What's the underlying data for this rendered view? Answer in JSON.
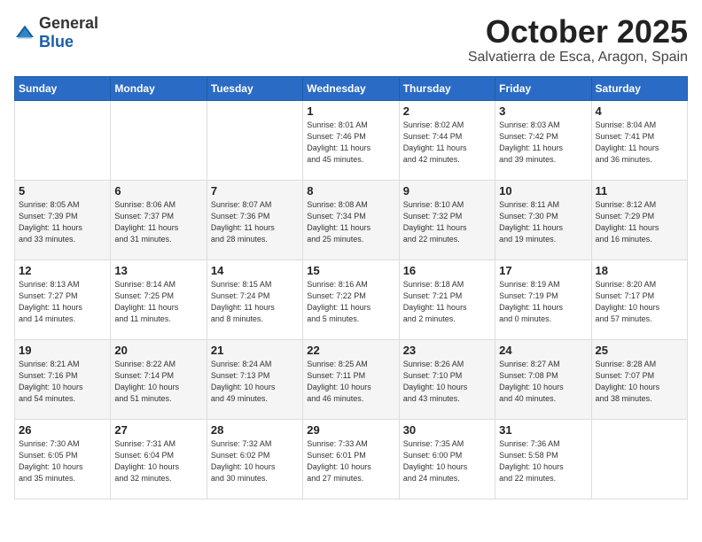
{
  "header": {
    "logo_general": "General",
    "logo_blue": "Blue",
    "month": "October 2025",
    "location": "Salvatierra de Esca, Aragon, Spain"
  },
  "weekdays": [
    "Sunday",
    "Monday",
    "Tuesday",
    "Wednesday",
    "Thursday",
    "Friday",
    "Saturday"
  ],
  "weeks": [
    [
      {
        "day": "",
        "info": ""
      },
      {
        "day": "",
        "info": ""
      },
      {
        "day": "",
        "info": ""
      },
      {
        "day": "1",
        "info": "Sunrise: 8:01 AM\nSunset: 7:46 PM\nDaylight: 11 hours\nand 45 minutes."
      },
      {
        "day": "2",
        "info": "Sunrise: 8:02 AM\nSunset: 7:44 PM\nDaylight: 11 hours\nand 42 minutes."
      },
      {
        "day": "3",
        "info": "Sunrise: 8:03 AM\nSunset: 7:42 PM\nDaylight: 11 hours\nand 39 minutes."
      },
      {
        "day": "4",
        "info": "Sunrise: 8:04 AM\nSunset: 7:41 PM\nDaylight: 11 hours\nand 36 minutes."
      }
    ],
    [
      {
        "day": "5",
        "info": "Sunrise: 8:05 AM\nSunset: 7:39 PM\nDaylight: 11 hours\nand 33 minutes."
      },
      {
        "day": "6",
        "info": "Sunrise: 8:06 AM\nSunset: 7:37 PM\nDaylight: 11 hours\nand 31 minutes."
      },
      {
        "day": "7",
        "info": "Sunrise: 8:07 AM\nSunset: 7:36 PM\nDaylight: 11 hours\nand 28 minutes."
      },
      {
        "day": "8",
        "info": "Sunrise: 8:08 AM\nSunset: 7:34 PM\nDaylight: 11 hours\nand 25 minutes."
      },
      {
        "day": "9",
        "info": "Sunrise: 8:10 AM\nSunset: 7:32 PM\nDaylight: 11 hours\nand 22 minutes."
      },
      {
        "day": "10",
        "info": "Sunrise: 8:11 AM\nSunset: 7:30 PM\nDaylight: 11 hours\nand 19 minutes."
      },
      {
        "day": "11",
        "info": "Sunrise: 8:12 AM\nSunset: 7:29 PM\nDaylight: 11 hours\nand 16 minutes."
      }
    ],
    [
      {
        "day": "12",
        "info": "Sunrise: 8:13 AM\nSunset: 7:27 PM\nDaylight: 11 hours\nand 14 minutes."
      },
      {
        "day": "13",
        "info": "Sunrise: 8:14 AM\nSunset: 7:25 PM\nDaylight: 11 hours\nand 11 minutes."
      },
      {
        "day": "14",
        "info": "Sunrise: 8:15 AM\nSunset: 7:24 PM\nDaylight: 11 hours\nand 8 minutes."
      },
      {
        "day": "15",
        "info": "Sunrise: 8:16 AM\nSunset: 7:22 PM\nDaylight: 11 hours\nand 5 minutes."
      },
      {
        "day": "16",
        "info": "Sunrise: 8:18 AM\nSunset: 7:21 PM\nDaylight: 11 hours\nand 2 minutes."
      },
      {
        "day": "17",
        "info": "Sunrise: 8:19 AM\nSunset: 7:19 PM\nDaylight: 11 hours\nand 0 minutes."
      },
      {
        "day": "18",
        "info": "Sunrise: 8:20 AM\nSunset: 7:17 PM\nDaylight: 10 hours\nand 57 minutes."
      }
    ],
    [
      {
        "day": "19",
        "info": "Sunrise: 8:21 AM\nSunset: 7:16 PM\nDaylight: 10 hours\nand 54 minutes."
      },
      {
        "day": "20",
        "info": "Sunrise: 8:22 AM\nSunset: 7:14 PM\nDaylight: 10 hours\nand 51 minutes."
      },
      {
        "day": "21",
        "info": "Sunrise: 8:24 AM\nSunset: 7:13 PM\nDaylight: 10 hours\nand 49 minutes."
      },
      {
        "day": "22",
        "info": "Sunrise: 8:25 AM\nSunset: 7:11 PM\nDaylight: 10 hours\nand 46 minutes."
      },
      {
        "day": "23",
        "info": "Sunrise: 8:26 AM\nSunset: 7:10 PM\nDaylight: 10 hours\nand 43 minutes."
      },
      {
        "day": "24",
        "info": "Sunrise: 8:27 AM\nSunset: 7:08 PM\nDaylight: 10 hours\nand 40 minutes."
      },
      {
        "day": "25",
        "info": "Sunrise: 8:28 AM\nSunset: 7:07 PM\nDaylight: 10 hours\nand 38 minutes."
      }
    ],
    [
      {
        "day": "26",
        "info": "Sunrise: 7:30 AM\nSunset: 6:05 PM\nDaylight: 10 hours\nand 35 minutes."
      },
      {
        "day": "27",
        "info": "Sunrise: 7:31 AM\nSunset: 6:04 PM\nDaylight: 10 hours\nand 32 minutes."
      },
      {
        "day": "28",
        "info": "Sunrise: 7:32 AM\nSunset: 6:02 PM\nDaylight: 10 hours\nand 30 minutes."
      },
      {
        "day": "29",
        "info": "Sunrise: 7:33 AM\nSunset: 6:01 PM\nDaylight: 10 hours\nand 27 minutes."
      },
      {
        "day": "30",
        "info": "Sunrise: 7:35 AM\nSunset: 6:00 PM\nDaylight: 10 hours\nand 24 minutes."
      },
      {
        "day": "31",
        "info": "Sunrise: 7:36 AM\nSunset: 5:58 PM\nDaylight: 10 hours\nand 22 minutes."
      },
      {
        "day": "",
        "info": ""
      }
    ]
  ]
}
